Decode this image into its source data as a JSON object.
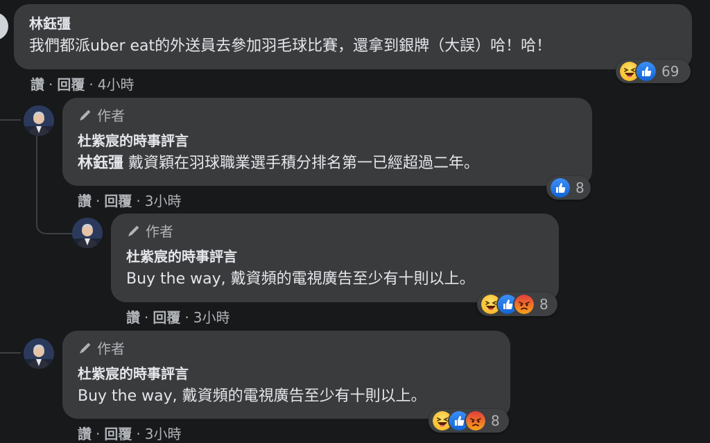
{
  "comments": [
    {
      "author": "林鈺彊",
      "text": "我們都派uber eat的外送員去參加羽毛球比賽，還拿到銀牌（大誤）哈！哈！",
      "actions": {
        "like": "讚",
        "reply": "回覆",
        "time": "4小時"
      },
      "reactions": {
        "icons": [
          "haha-icon",
          "like-icon"
        ],
        "count": "69"
      }
    },
    {
      "badge": "作者",
      "author": "杜紫宸的時事評言",
      "mention": "林鈺彊",
      "text": "戴資穎在羽球職業選手積分排名第一已經超過二年。",
      "actions": {
        "like": "讚",
        "reply": "回覆",
        "time": "3小時"
      },
      "reactions": {
        "icons": [
          "like-icon"
        ],
        "count": "8"
      }
    },
    {
      "badge": "作者",
      "author": "杜紫宸的時事評言",
      "text": "Buy the way, 戴資頻的電視廣告至少有十則以上。",
      "actions": {
        "like": "讚",
        "reply": "回覆",
        "time": "3小時"
      },
      "reactions": {
        "icons": [
          "haha-icon",
          "like-icon",
          "angry-icon"
        ],
        "count": "8"
      }
    },
    {
      "badge": "作者",
      "author": "杜紫宸的時事評言",
      "text": "Buy the way, 戴資頻的電視廣告至少有十則以上。",
      "actions": {
        "like": "讚",
        "reply": "回覆",
        "time": "3小時"
      },
      "reactions": {
        "icons": [
          "haha-icon",
          "like-icon",
          "angry-icon"
        ],
        "count": "8"
      }
    }
  ],
  "colors": {
    "background": "#18191a",
    "bubble": "#3a3b3c",
    "text": "#e4e6eb",
    "muted": "#b0b3b8",
    "like": "#1877f2",
    "haha": "#f7b928",
    "angry": "#e9710f"
  }
}
